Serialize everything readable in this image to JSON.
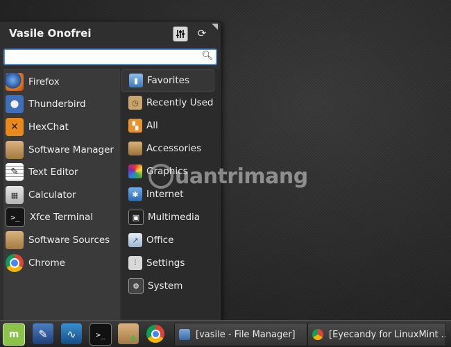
{
  "menu": {
    "user_name": "Vasile Onofrei",
    "search": {
      "value": "",
      "placeholder": ""
    },
    "apps": [
      {
        "label": "Firefox",
        "icon": "firefox-icon"
      },
      {
        "label": "Thunderbird",
        "icon": "thunderbird-icon"
      },
      {
        "label": "HexChat",
        "icon": "hexchat-icon"
      },
      {
        "label": "Software Manager",
        "icon": "software-manager-icon"
      },
      {
        "label": "Text Editor",
        "icon": "text-editor-icon"
      },
      {
        "label": "Calculator",
        "icon": "calculator-icon"
      },
      {
        "label": "Xfce Terminal",
        "icon": "terminal-icon"
      },
      {
        "label": "Software Sources",
        "icon": "software-sources-icon"
      },
      {
        "label": "Chrome",
        "icon": "chrome-icon"
      }
    ],
    "categories": [
      {
        "label": "Favorites",
        "icon": "favorites-icon"
      },
      {
        "label": "Recently Used",
        "icon": "recently-used-icon"
      },
      {
        "label": "All",
        "icon": "all-icon"
      },
      {
        "label": "Accessories",
        "icon": "accessories-icon"
      },
      {
        "label": "Graphics",
        "icon": "graphics-icon"
      },
      {
        "label": "Internet",
        "icon": "internet-icon"
      },
      {
        "label": "Multimedia",
        "icon": "multimedia-icon"
      },
      {
        "label": "Office",
        "icon": "office-icon"
      },
      {
        "label": "Settings",
        "icon": "settings-icon"
      },
      {
        "label": "System",
        "icon": "system-icon"
      }
    ]
  },
  "taskbar": {
    "launchers": [
      "mint-menu-icon",
      "window-manager-icon",
      "system-monitor-icon",
      "terminal-icon",
      "software-manager-icon",
      "chrome-icon"
    ],
    "tasks": [
      {
        "label": "[vasile - File Manager]",
        "icon": "file-manager-icon"
      },
      {
        "label": "[Eyecandy for LinuxMint ...",
        "icon": "chrome-icon"
      }
    ]
  },
  "watermark": "uantrimang"
}
